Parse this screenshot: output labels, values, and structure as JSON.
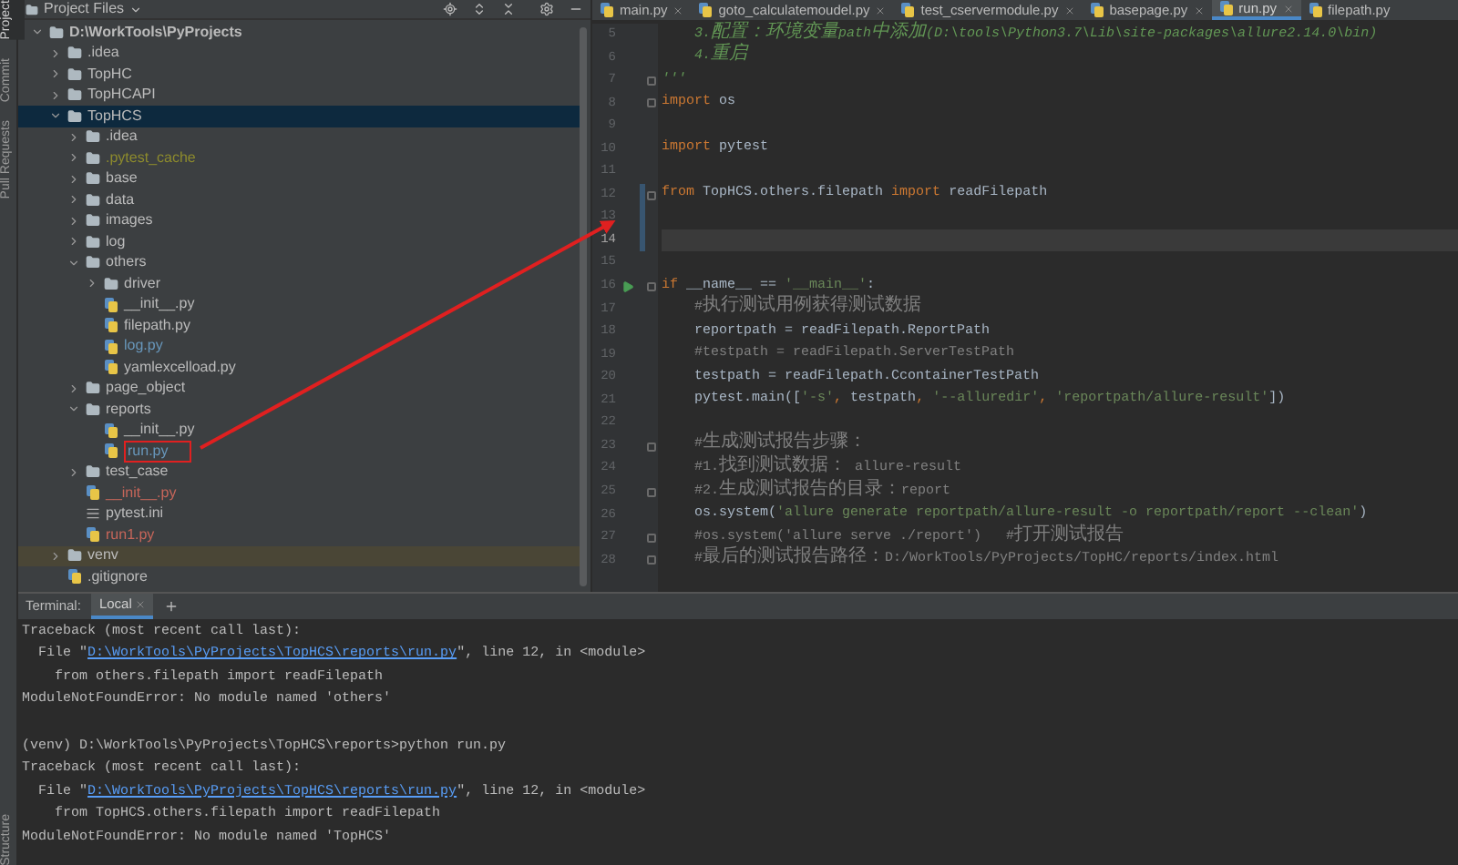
{
  "tool_strip": {
    "top": [
      {
        "label": "Project",
        "selected": true
      },
      {
        "label": "Commit",
        "selected": false
      },
      {
        "label": "Pull Requests",
        "selected": false
      }
    ],
    "bottom": [
      {
        "label": "Structure",
        "selected": false
      }
    ]
  },
  "project_panel": {
    "title": "Project Files",
    "tree": [
      {
        "name": "D:\\WorkTools\\PyProjects",
        "kind": "project",
        "color": "#bbbbbb",
        "selected": false,
        "expanded": true,
        "children": [
          {
            "name": ".idea",
            "kind": "folder",
            "color": "#bbbbbb",
            "selected": false,
            "expanded": false
          },
          {
            "name": "TopHC",
            "kind": "folder",
            "color": "#bbbbbb",
            "selected": false,
            "expanded": false
          },
          {
            "name": "TopHCAPI",
            "kind": "folder",
            "color": "#bbbbbb",
            "selected": false,
            "expanded": false
          },
          {
            "name": "TopHCS",
            "kind": "folder",
            "color": "#bbbbbb",
            "selected": true,
            "expanded": true,
            "children": [
              {
                "name": ".idea",
                "kind": "folder",
                "color": "#bbbbbb",
                "selected": false,
                "expanded": false
              },
              {
                "name": ".pytest_cache",
                "kind": "folder",
                "color": "#8d8b2d",
                "selected": false,
                "expanded": false
              },
              {
                "name": "base",
                "kind": "folder",
                "color": "#bbbbbb",
                "selected": false,
                "expanded": false
              },
              {
                "name": "data",
                "kind": "folder",
                "color": "#bbbbbb",
                "selected": false,
                "expanded": false
              },
              {
                "name": "images",
                "kind": "folder",
                "color": "#bbbbbb",
                "selected": false,
                "expanded": false
              },
              {
                "name": "log",
                "kind": "folder",
                "color": "#bbbbbb",
                "selected": false,
                "expanded": false
              },
              {
                "name": "others",
                "kind": "folder",
                "color": "#bbbbbb",
                "selected": false,
                "expanded": true,
                "children": [
                  {
                    "name": "driver",
                    "kind": "folder",
                    "color": "#bbbbbb",
                    "selected": false,
                    "expanded": false
                  },
                  {
                    "name": "__init__.py",
                    "kind": "python",
                    "color": "#bbbbbb",
                    "selected": false
                  },
                  {
                    "name": "filepath.py",
                    "kind": "python",
                    "color": "#bbbbbb",
                    "selected": false
                  },
                  {
                    "name": "log.py",
                    "kind": "python",
                    "color": "#6897bb",
                    "selected": false
                  },
                  {
                    "name": "yamlexcelload.py",
                    "kind": "python",
                    "color": "#bbbbbb",
                    "selected": false
                  }
                ]
              },
              {
                "name": "page_object",
                "kind": "folder",
                "color": "#bbbbbb",
                "selected": false,
                "expanded": false
              },
              {
                "name": "reports",
                "kind": "folder",
                "color": "#bbbbbb",
                "selected": false,
                "expanded": true,
                "children": [
                  {
                    "name": "__init__.py",
                    "kind": "python",
                    "color": "#bbbbbb",
                    "selected": false
                  },
                  {
                    "name": "run.py",
                    "kind": "python",
                    "color": "#6897bb",
                    "selected": false,
                    "annotated": true
                  }
                ]
              },
              {
                "name": "test_case",
                "kind": "folder",
                "color": "#bbbbbb",
                "selected": false,
                "expanded": false
              },
              {
                "name": "__init__.py",
                "kind": "python",
                "color": "#c7665a",
                "selected": false
              },
              {
                "name": "pytest.ini",
                "kind": "ini",
                "color": "#bbbbbb",
                "selected": false
              },
              {
                "name": "run1.py",
                "kind": "python",
                "color": "#c7665a",
                "selected": false
              }
            ]
          },
          {
            "name": "venv",
            "kind": "folder",
            "color": "#bbbbbb",
            "selected": false,
            "highlighted": true,
            "expanded": false
          },
          {
            "name": ".gitignore",
            "kind": "python",
            "color": "#bbbbbb",
            "selected": false
          }
        ]
      }
    ]
  },
  "editor": {
    "tabs": [
      {
        "label": "main.py",
        "selected": false,
        "closable": true
      },
      {
        "label": "goto_calculatemoudel.py",
        "selected": false,
        "closable": true
      },
      {
        "label": "test_cservermodule.py",
        "selected": false,
        "closable": true
      },
      {
        "label": "basepage.py",
        "selected": false,
        "closable": true
      },
      {
        "label": "run.py",
        "selected": true,
        "closable": true
      },
      {
        "label": "filepath.py",
        "selected": false,
        "closable": false
      }
    ],
    "lines": [
      {
        "number": "5",
        "segments": [
          {
            "kind": "doc",
            "text": "    3.配置：环境变量path中添加(D:\\tools\\Python3.7\\Lib\\site-packages\\allure2.14.0\\bin)"
          }
        ]
      },
      {
        "number": "6",
        "segments": [
          {
            "kind": "doc",
            "text": "    4.重启"
          }
        ]
      },
      {
        "number": "7",
        "fold": true,
        "segments": [
          {
            "kind": "doc",
            "text": "'''"
          }
        ]
      },
      {
        "number": "8",
        "fold": true,
        "segments": [
          {
            "kind": "keyword",
            "text": "import"
          },
          {
            "kind": "plain",
            "text": " os"
          }
        ]
      },
      {
        "number": "9"
      },
      {
        "number": "10",
        "segments": [
          {
            "kind": "keyword",
            "text": "import"
          },
          {
            "kind": "plain",
            "text": " pytest"
          }
        ]
      },
      {
        "number": "11"
      },
      {
        "number": "12",
        "fold": true,
        "changed": true,
        "segments": [
          {
            "kind": "keyword",
            "text": "from"
          },
          {
            "kind": "plain",
            "text": " TopHCS.others.filepath "
          },
          {
            "kind": "keyword",
            "text": "import"
          },
          {
            "kind": "plain",
            "text": " readFilepath"
          }
        ]
      },
      {
        "number": "13",
        "changed": true
      },
      {
        "number": "14",
        "changed": true,
        "current": true
      },
      {
        "number": "15"
      },
      {
        "number": "16",
        "fold": true,
        "runnable": true,
        "segments": [
          {
            "kind": "keyword",
            "text": "if"
          },
          {
            "kind": "plain",
            "text": " __name__ == "
          },
          {
            "kind": "string",
            "text": "'__main__'"
          },
          {
            "kind": "plain",
            "text": ":"
          }
        ]
      },
      {
        "number": "17",
        "segments": [
          {
            "kind": "comment",
            "text": "    #执行测试用例获得测试数据"
          }
        ]
      },
      {
        "number": "18",
        "segments": [
          {
            "kind": "plain",
            "text": "    reportpath = readFilepath.ReportPath"
          }
        ]
      },
      {
        "number": "19",
        "segments": [
          {
            "kind": "comment",
            "text": "    #testpath = readFilepath.ServerTestPath"
          }
        ]
      },
      {
        "number": "20",
        "segments": [
          {
            "kind": "plain",
            "text": "    testpath = readFilepath.CcontainerTestPath"
          }
        ]
      },
      {
        "number": "21",
        "segments": [
          {
            "kind": "plain",
            "text": "    pytest.main(["
          },
          {
            "kind": "string",
            "text": "'-s'"
          },
          {
            "kind": "keyword",
            "text": ","
          },
          {
            "kind": "plain",
            "text": " testpath"
          },
          {
            "kind": "keyword",
            "text": ","
          },
          {
            "kind": "string",
            "text": " '--alluredir'"
          },
          {
            "kind": "keyword",
            "text": ","
          },
          {
            "kind": "string",
            "text": " 'reportpath/allure-result'"
          },
          {
            "kind": "plain",
            "text": "])"
          }
        ]
      },
      {
        "number": "22"
      },
      {
        "number": "23",
        "fold": true,
        "segments": [
          {
            "kind": "comment",
            "text": "    #生成测试报告步骤："
          }
        ]
      },
      {
        "number": "24",
        "segments": [
          {
            "kind": "comment",
            "text": "    #1.找到测试数据： allure-result"
          }
        ]
      },
      {
        "number": "25",
        "fold": true,
        "segments": [
          {
            "kind": "comment",
            "text": "    #2.生成测试报告的目录：report"
          }
        ]
      },
      {
        "number": "26",
        "segments": [
          {
            "kind": "plain",
            "text": "    os.system("
          },
          {
            "kind": "string",
            "text": "'allure generate reportpath/allure-result -o reportpath/report --clean'"
          },
          {
            "kind": "plain",
            "text": ")"
          }
        ]
      },
      {
        "number": "27",
        "fold": true,
        "segments": [
          {
            "kind": "comment",
            "text": "    #os.system('allure serve ./report')   #打开测试报告"
          }
        ]
      },
      {
        "number": "28",
        "fold": true,
        "segments": [
          {
            "kind": "comment",
            "text": "    #最后的测试报告路径：D:/WorkTools/PyProjects/TopHC/reports/index.html"
          }
        ]
      }
    ]
  },
  "terminal": {
    "title": "Terminal:",
    "tabs": [
      {
        "label": "Local",
        "selected": true
      }
    ],
    "blocks": [
      [
        [
          {
            "kind": "plain",
            "text": "Traceback (most recent call last):"
          }
        ],
        [
          {
            "kind": "plain",
            "text": "  File \""
          },
          {
            "kind": "link",
            "text": "D:\\WorkTools\\PyProjects\\TopHCS\\reports\\run.py"
          },
          {
            "kind": "plain",
            "text": "\", line 12, in <module>"
          }
        ],
        [
          {
            "kind": "plain",
            "text": "    from others.filepath import readFilepath"
          }
        ],
        [
          {
            "kind": "plain",
            "text": "ModuleNotFoundError: No module named 'others'"
          }
        ]
      ],
      [
        [
          {
            "kind": "plain",
            "text": "(venv) D:\\WorkTools\\PyProjects\\TopHCS\\reports>python run.py"
          }
        ],
        [
          {
            "kind": "plain",
            "text": "Traceback (most recent call last):"
          }
        ],
        [
          {
            "kind": "plain",
            "text": "  File \""
          },
          {
            "kind": "link",
            "text": "D:\\WorkTools\\PyProjects\\TopHCS\\reports\\run.py"
          },
          {
            "kind": "plain",
            "text": "\", line 12, in <module>"
          }
        ],
        [
          {
            "kind": "plain",
            "text": "    from TopHCS.others.filepath import readFilepath"
          }
        ],
        [
          {
            "kind": "plain",
            "text": "ModuleNotFoundError: No module named 'TopHCS'"
          }
        ]
      ]
    ]
  }
}
